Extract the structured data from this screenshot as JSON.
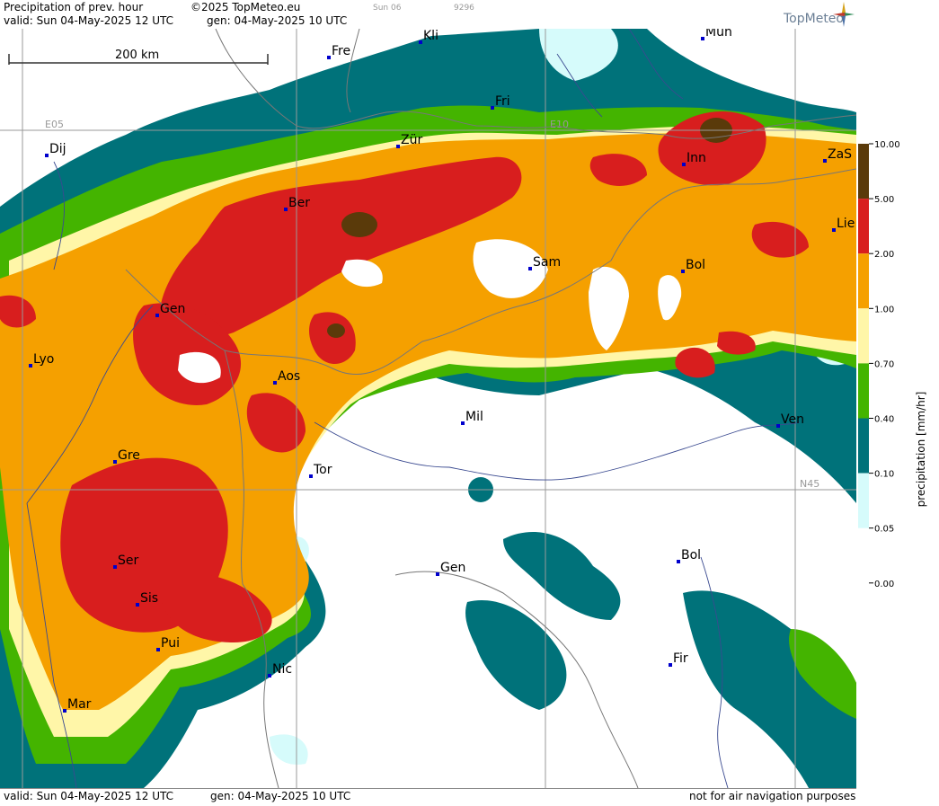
{
  "header": {
    "title": "Precipitation of prev. hour",
    "copyright": "©2025 TopMeteo.eu",
    "valid": "valid:  Sun  04-May-2025  12 UTC",
    "gen": "gen: 04-May-2025 10 UTC",
    "small1": "Sun 06",
    "small2": "9296",
    "logo": "TopMeteo"
  },
  "footer": {
    "valid": "valid:  Sun  04-May-2025  12 UTC",
    "gen": "gen: 04-May-2025 10 UTC",
    "note": "not for air navigation purposes"
  },
  "scale_label": "200 km",
  "grid_labels": {
    "lon": "E05",
    "lon2": "E10",
    "lat": "N45"
  },
  "legend": {
    "title": "precipitation  [mm/hr]",
    "ticks": [
      "10.00",
      "5.00",
      "2.00",
      "1.00",
      "0.70",
      "0.40",
      "0.10",
      "0.05",
      "0.00"
    ],
    "colors": [
      "#5a3a0a",
      "#d81e1e",
      "#f5a000",
      "#fff6a8",
      "#44b400",
      "#00727a",
      "#d6fbfb",
      "#ffffff"
    ]
  },
  "cities": [
    {
      "name": "Kli"
    },
    {
      "name": "Mün"
    },
    {
      "name": "Fre"
    },
    {
      "name": "Fri"
    },
    {
      "name": "Dij"
    },
    {
      "name": "Zür"
    },
    {
      "name": "Inn"
    },
    {
      "name": "ZaS"
    },
    {
      "name": "Ber"
    },
    {
      "name": "Lie"
    },
    {
      "name": "Sam"
    },
    {
      "name": "Bol"
    },
    {
      "name": "Gen"
    },
    {
      "name": "Lyo"
    },
    {
      "name": "Aos"
    },
    {
      "name": "Mil"
    },
    {
      "name": "Ven"
    },
    {
      "name": "Gre"
    },
    {
      "name": "Tor"
    },
    {
      "name": "Gen"
    },
    {
      "name": "Bol"
    },
    {
      "name": "Ser"
    },
    {
      "name": "Sis"
    },
    {
      "name": "Pui"
    },
    {
      "name": "Nic"
    },
    {
      "name": "Fir"
    },
    {
      "name": "Mar"
    }
  ]
}
